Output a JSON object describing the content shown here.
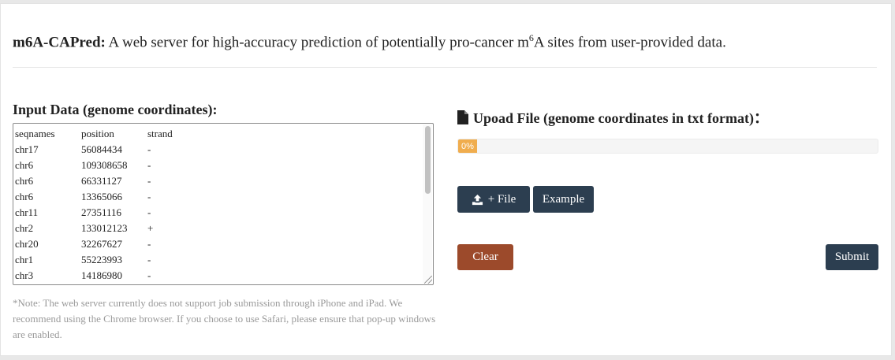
{
  "header": {
    "app_name": "m6A-CAPred:",
    "desc_before": " A web server for high-accuracy prediction of potentially pro-cancer m",
    "desc_sup": "6",
    "desc_after": "A sites from user-provided data."
  },
  "input": {
    "title": "Input Data (genome coordinates):",
    "columns": [
      "seqnames",
      "position",
      "strand"
    ],
    "rows": [
      [
        "chr17",
        "56084434",
        "-"
      ],
      [
        "chr6",
        "109308658",
        "-"
      ],
      [
        "chr6",
        "66331127",
        "-"
      ],
      [
        "chr6",
        "13365066",
        "-"
      ],
      [
        "chr11",
        "27351116",
        "-"
      ],
      [
        "chr2",
        "133012123",
        "+"
      ],
      [
        "chr20",
        "32267627",
        "-"
      ],
      [
        "chr1",
        "55223993",
        "-"
      ],
      [
        "chr3",
        "14186980",
        "-"
      ]
    ],
    "note": "*Note: The web server currently does not support job submission through iPhone and iPad. We recommend using the Chrome browser. If you choose to use Safari, please ensure that pop-up windows are enabled."
  },
  "upload": {
    "title": "Upoad File (genome coordinates in txt format)：",
    "progress_label": "0%",
    "progress_value": 0,
    "progress_color": "#f0ad4e",
    "file_button": "+ File",
    "example_button": "Example",
    "clear_button": "Clear",
    "submit_button": "Submit",
    "icons": [
      "file-icon",
      "upload-icon"
    ]
  },
  "colors": {
    "dark_button": "#2c3e50",
    "clear_button": "#9c4a2b",
    "note_text": "#9a9a9a"
  }
}
